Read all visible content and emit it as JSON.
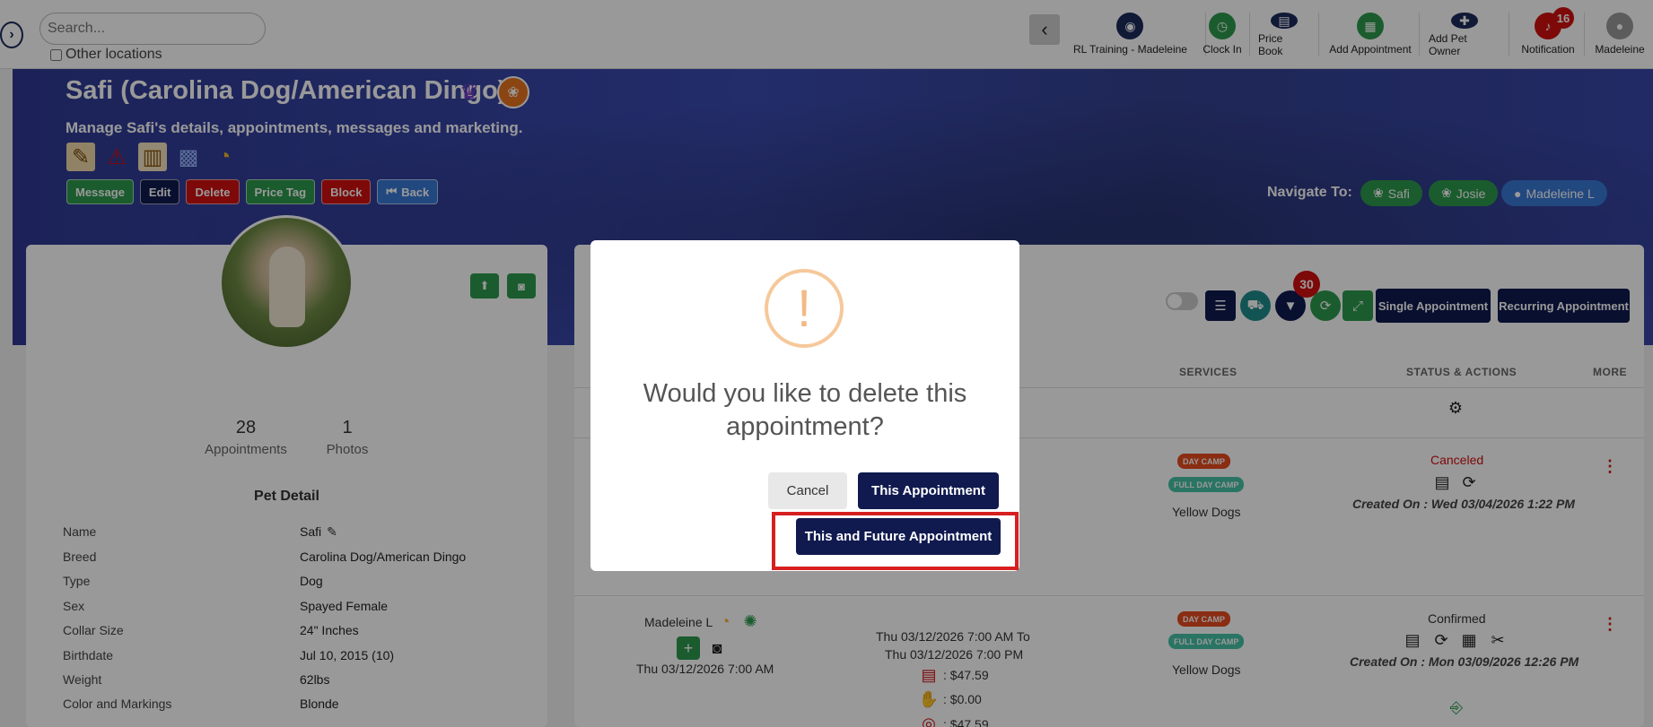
{
  "topbar": {
    "search_placeholder": "Search...",
    "other_locations_label": "Other locations",
    "nav": [
      {
        "label": "RL Training - Madeleine",
        "icon": "location-pin-icon",
        "color": "#1c2a5b"
      },
      {
        "label": "Clock In",
        "icon": "clock-icon",
        "color": "#2e9a4d"
      },
      {
        "label": "Price Book",
        "icon": "price-book-icon",
        "color": "#1c2a5b"
      },
      {
        "label": "Add Appointment",
        "icon": "add-appointment-icon",
        "color": "#2e9a4d"
      },
      {
        "label": "Add Pet Owner",
        "icon": "add-user-icon",
        "color": "#1c2a5b"
      },
      {
        "label": "Notification",
        "icon": "bell-icon",
        "color": "#d01010",
        "badge": "16"
      },
      {
        "label": "Madeleine",
        "icon": "user-avatar-icon",
        "color": "#9a9a9a"
      }
    ]
  },
  "hero": {
    "title": "Safi (Carolina Dog/American Dingo)",
    "subtitle": "Manage Safi's details, appointments, messages and marketing.",
    "buttons": [
      {
        "label": "Message",
        "color": "#2e9a4d"
      },
      {
        "label": "Edit",
        "color": "#101a4f"
      },
      {
        "label": "Delete",
        "color": "#d01010"
      },
      {
        "label": "Price Tag",
        "color": "#2e9a4d"
      },
      {
        "label": "Block",
        "color": "#d01010"
      },
      {
        "label": "Back",
        "color": "#3a78d6"
      }
    ],
    "navigate_label": "Navigate To:",
    "navigate": [
      {
        "label": "Safi",
        "color": "#2e9a4d"
      },
      {
        "label": "Josie",
        "color": "#2e9a4d"
      },
      {
        "label": "Madeleine L",
        "color": "#3a78d6"
      }
    ]
  },
  "pet_card": {
    "stats": [
      {
        "value": "28",
        "label": "Appointments"
      },
      {
        "value": "1",
        "label": "Photos"
      }
    ],
    "detail_title": "Pet Detail",
    "details": [
      {
        "key": "Name",
        "value": "Safi"
      },
      {
        "key": "Breed",
        "value": "Carolina Dog/American Dingo"
      },
      {
        "key": "Type",
        "value": "Dog"
      },
      {
        "key": "Sex",
        "value": "Spayed Female"
      },
      {
        "key": "Collar Size",
        "value": "24\" Inches"
      },
      {
        "key": "Birthdate",
        "value": "Jul 10, 2015  (10)"
      },
      {
        "key": "Weight",
        "value": "62lbs"
      },
      {
        "key": "Color and Markings",
        "value": "Blonde"
      }
    ]
  },
  "appointments": {
    "filter_badge": "30",
    "single_label": "Single Appointment",
    "recurring_label": "Recurring Appointment",
    "columns": {
      "services": "SERVICES",
      "status": "STATUS & ACTIONS",
      "more": "MORE"
    },
    "rows": [
      {
        "tag1": "DAY CAMP",
        "tag2": "FULL DAY CAMP",
        "group": "Yellow Dogs",
        "status": "Canceled",
        "created": "Created On : Wed 03/04/2026 1:22 PM"
      },
      {
        "staff": "Madeleine L",
        "date": "Thu 03/12/2026 7:00 AM",
        "range1": "Thu 03/12/2026 7:00 AM To",
        "range2": "Thu 03/12/2026 7:00 PM",
        "price1": ": $47.59",
        "price2": ": $0.00",
        "price3": ": $47.59",
        "tag1": "DAY CAMP",
        "tag2": "FULL DAY CAMP",
        "group": "Yellow Dogs",
        "status": "Confirmed",
        "created": "Created On : Mon 03/09/2026 12:26 PM"
      }
    ]
  },
  "modal": {
    "icon": "exclamation-icon",
    "title_line1": "Would you like to delete this",
    "title_line2": "appointment?",
    "cancel_label": "Cancel",
    "this_label": "This Appointment",
    "future_label": "This and Future Appointment"
  }
}
